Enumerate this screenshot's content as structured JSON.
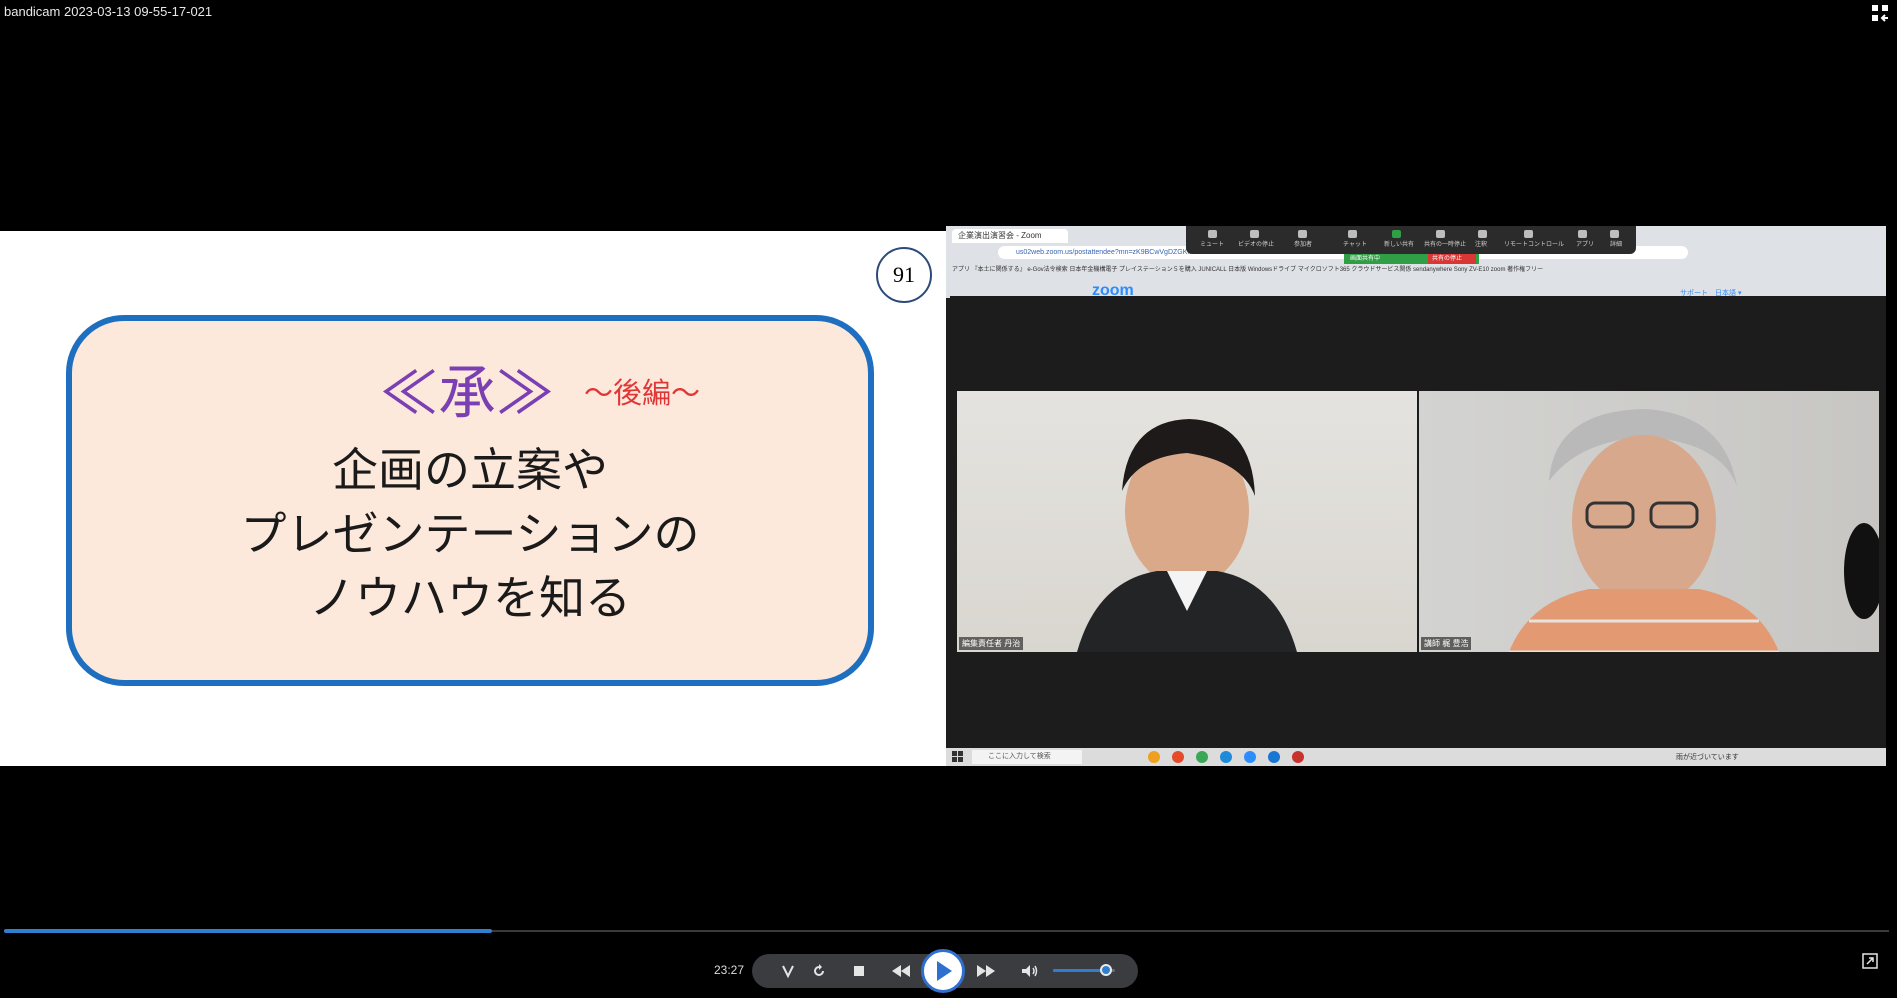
{
  "window": {
    "title": "bandicam 2023-03-13 09-55-17-021"
  },
  "slide": {
    "page_number": "91",
    "heading": "≪承≫",
    "subheading": "～後編～",
    "line1": "企画の立案や",
    "line2": "プレゼンテーションの",
    "line3": "ノウハウを知る"
  },
  "screen_capture": {
    "tab_title": "企業演出演習会 - Zoom",
    "url": "us02web.zoom.us/postattendee?mn=zK9BCwVgDZGKM",
    "bookmarks": "アプリ 『本土に関係する』 e-Gov法令検索 日本年金機構電子 プレイステーション５を購入 JUNICALL 日本版 Windowsドライブ マイクロソフト365 クラウドサービス関係 sendanywhere Sony ZV-E10 zoom 著作権フリー",
    "zoom_toolbar": [
      "ミュート",
      "ビデオの停止",
      "参加者",
      "チャット",
      "新しい共有",
      "共有の一時停止",
      "注釈",
      "リモートコントロール",
      "アプリ",
      "詳細"
    ],
    "share_status": "画面共有中",
    "stop_share": "共有の停止",
    "zoom_logo": "zoom",
    "zoom_links": "サポート　日本語 ▾",
    "participant_1_name": "編集責任者 丹治",
    "participant_2_name": "講師 梶 豊浩",
    "taskbar_search": "ここに入力して検索",
    "taskbar_weather": "雨が近づいています"
  },
  "player": {
    "time": "23:27",
    "progress": 0.259,
    "volume": 0.85
  },
  "colors": {
    "accent": "#2f7fd0",
    "slide_border": "#1f6fc1",
    "slide_fill": "#fde9dc",
    "heading": "#7a3fb3",
    "subheading": "#e23636"
  }
}
